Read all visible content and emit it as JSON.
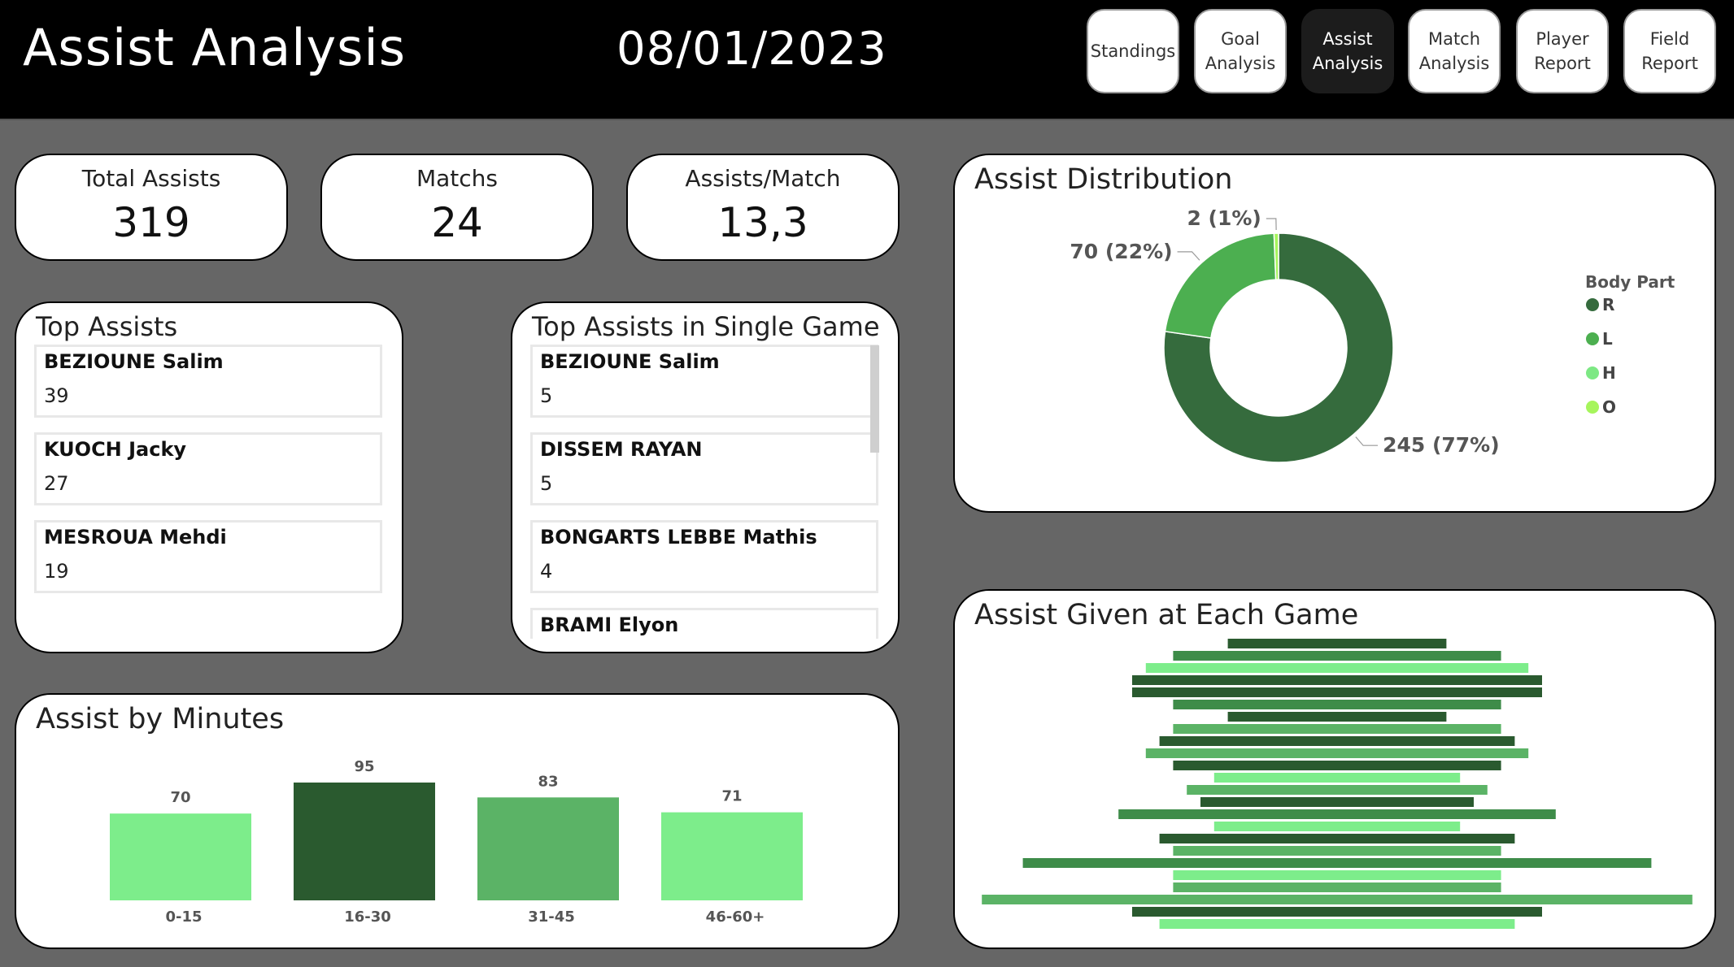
{
  "header": {
    "title": "Assist Analysis",
    "date": "08/01/2023",
    "nav": [
      {
        "lines": [
          "Standings"
        ],
        "active": false
      },
      {
        "lines": [
          "Goal",
          "Analysis"
        ],
        "active": false
      },
      {
        "lines": [
          "Assist",
          "Analysis"
        ],
        "active": true
      },
      {
        "lines": [
          "Match",
          "Analysis"
        ],
        "active": false
      },
      {
        "lines": [
          "Player",
          "Report"
        ],
        "active": false
      },
      {
        "lines": [
          "Field",
          "Report"
        ],
        "active": false
      }
    ]
  },
  "kpis": [
    {
      "label": "Total Assists",
      "value": "319"
    },
    {
      "label": "Matchs",
      "value": "24"
    },
    {
      "label": "Assists/Match",
      "value": "13,3"
    }
  ],
  "top_assists": {
    "title": "Top Assists",
    "items": [
      {
        "name": "BEZIOUNE Salim",
        "value": "39"
      },
      {
        "name": "KUOCH Jacky",
        "value": "27"
      },
      {
        "name": "MESROUA Mehdi",
        "value": "19"
      }
    ]
  },
  "top_single_game": {
    "title": "Top Assists in Single Game",
    "items": [
      {
        "name": "BEZIOUNE Salim",
        "value": "5"
      },
      {
        "name": "DISSEM RAYAN",
        "value": "5"
      },
      {
        "name": "BONGARTS LEBBE Mathis",
        "value": "4"
      },
      {
        "name": "BRAMI Elyon",
        "value": ""
      }
    ]
  },
  "colors": {
    "dark_green": "#2a5a2f",
    "donut_R": "#356b3d",
    "donut_L": "#4caf50",
    "donut_H": "#7de884",
    "donut_O": "#a6f55c"
  },
  "chart_data": [
    {
      "type": "bar",
      "title": "Assist by Minutes",
      "categories": [
        "0-15",
        "16-30",
        "31-45",
        "46-60+"
      ],
      "values": [
        70,
        95,
        83,
        71
      ],
      "colors": [
        "#7ded8b",
        "#2a5a2f",
        "#5bb366",
        "#7ded8b"
      ],
      "ylim": [
        0,
        100
      ]
    },
    {
      "type": "pie",
      "title": "Assist Distribution",
      "legend_title": "Body Part",
      "legend_position": "right",
      "slices": [
        {
          "name": "R",
          "value": 245,
          "label": "245 (77%)",
          "color": "#356b3d"
        },
        {
          "name": "L",
          "value": 70,
          "label": "70 (22%)",
          "color": "#4caf50"
        },
        {
          "name": "H",
          "value": 0,
          "label": "",
          "color": "#7de884"
        },
        {
          "name": "O",
          "value": 2,
          "label": "2 (1%)",
          "color": "#a6f55c"
        }
      ]
    },
    {
      "type": "bar",
      "title": "Assist Given at Each Game",
      "orientation": "horizontal-centered",
      "values": [
        16,
        24,
        28,
        30,
        30,
        24,
        16,
        24,
        26,
        28,
        24,
        18,
        22,
        20,
        32,
        18,
        26,
        24,
        46,
        24,
        24,
        52,
        30,
        26
      ],
      "colors": [
        "#2a5a2f",
        "#3e8c49",
        "#7ded8b",
        "#2a5a2f",
        "#2a5a2f",
        "#3e8c49",
        "#2a5a2f",
        "#5bb366",
        "#2a5a2f",
        "#5bb366",
        "#2a5a2f",
        "#7ded8b",
        "#5bb366",
        "#2a5a2f",
        "#3e8c49",
        "#7ded8b",
        "#2a5a2f",
        "#5bb366",
        "#3e8c49",
        "#7ded8b",
        "#5bb366",
        "#5bb366",
        "#2a5a2f",
        "#7ded8b"
      ]
    }
  ]
}
